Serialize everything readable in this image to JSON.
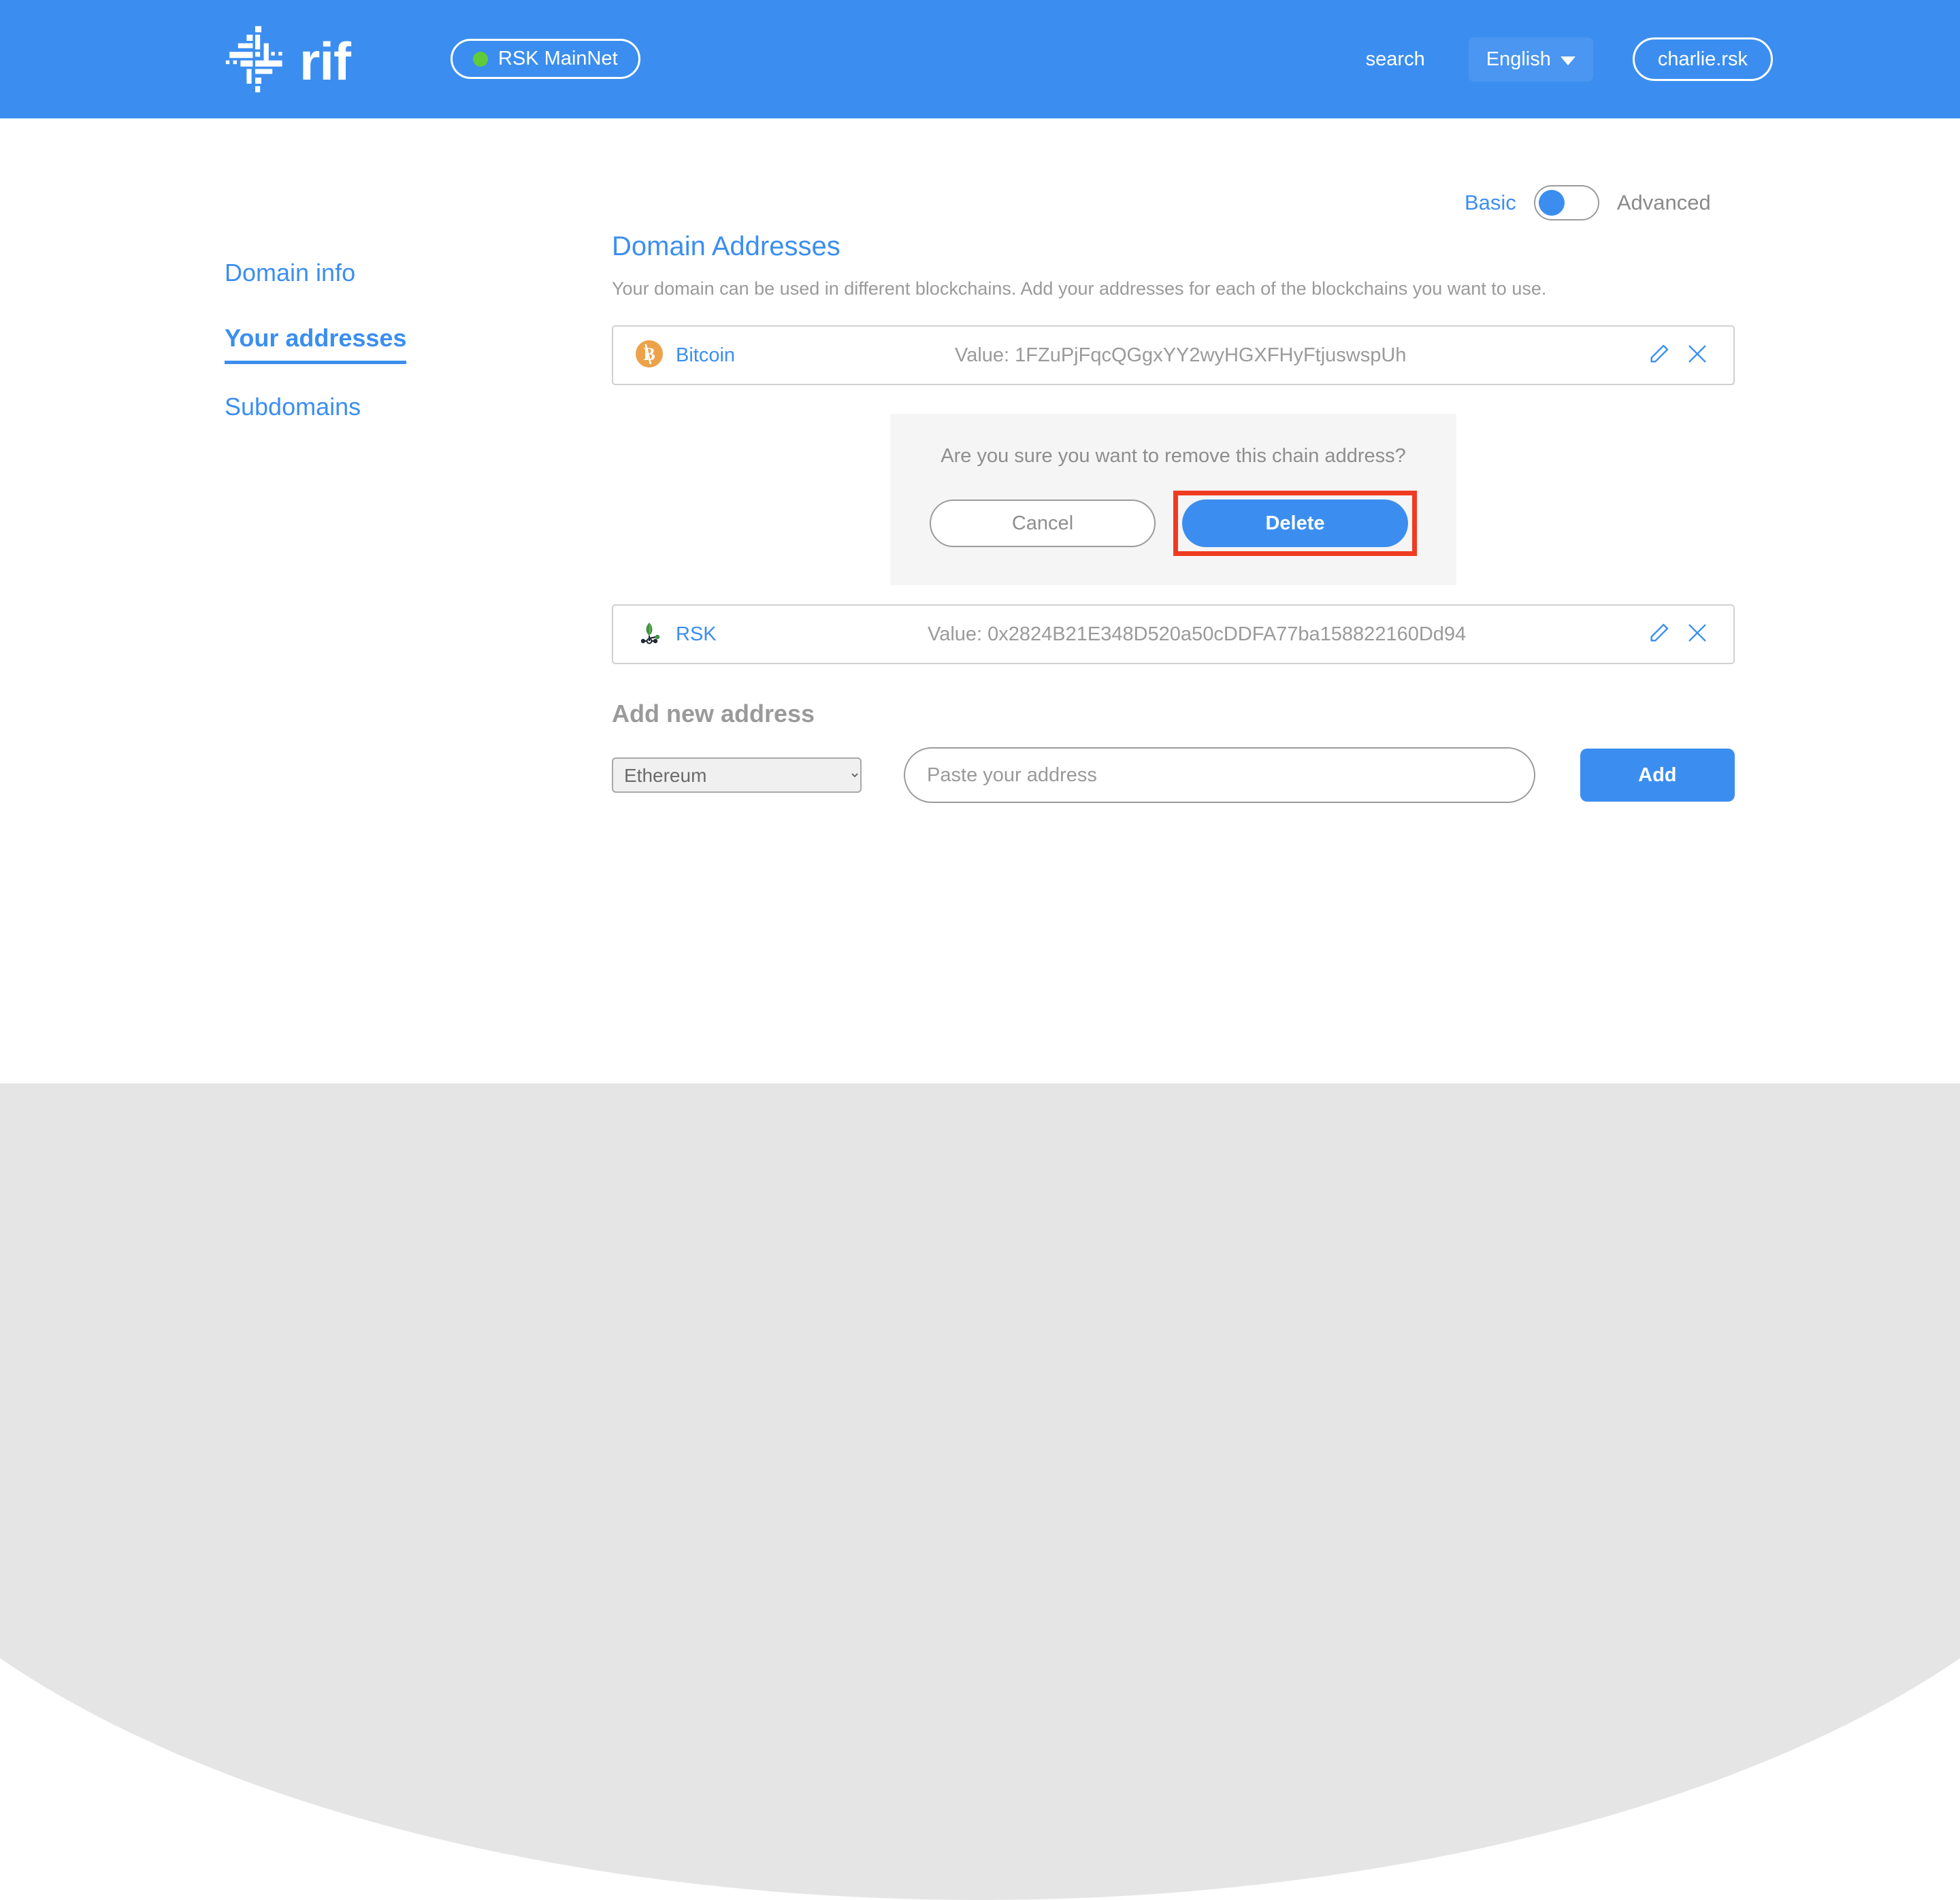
{
  "header": {
    "logo_text": "rif",
    "logo_icon": "rif-logo-icon",
    "network": {
      "label": "RSK MainNet",
      "status_dot": "green-status-dot",
      "dot_color": "#5fcb3a"
    },
    "search_label": "search",
    "language_label": "English",
    "language_caret": "chevron-down-icon",
    "account_label": "charlie.rsk",
    "background_color": "#3b8ef0"
  },
  "mode_toggle": {
    "basic_label": "Basic",
    "advanced_label": "Advanced",
    "selected": "Basic",
    "active_color": "#3b8ef0",
    "inactive_color": "#8a8a8a"
  },
  "sidebar": {
    "items": [
      {
        "label": "Domain info",
        "active": false
      },
      {
        "label": "Your addresses",
        "active": true
      },
      {
        "label": "Subdomains",
        "active": false
      }
    ]
  },
  "main": {
    "title": "Domain Addresses",
    "description": "Your domain can be used in different blockchains. Add your addresses for each of the blockchains you want to use.",
    "addresses": [
      {
        "chain": "Bitcoin",
        "chain_icon": "bitcoin-icon",
        "icon_color": "#eda24a",
        "value": "Value: 1FZuPjFqcQGgxYY2wyHGXFHyFtjuswspUh",
        "edit_icon": "pencil-icon",
        "delete_icon": "close-icon"
      },
      {
        "chain": "RSK",
        "chain_icon": "rsk-icon",
        "icon_color": "#4d8c3f",
        "value": "Value: 0x2824B21E348D520a50cDDFA77ba158822160Dd94",
        "edit_icon": "pencil-icon",
        "delete_icon": "close-icon"
      }
    ]
  },
  "confirm_dialog": {
    "message": "Are you sure you want to remove this chain address?",
    "cancel_label": "Cancel",
    "delete_label": "Delete",
    "highlight_color": "#ef3b22",
    "panel_background": "#f5f5f5"
  },
  "add_new_address": {
    "title": "Add new address",
    "chain_selected": "Ethereum",
    "chain_options": [
      "Ethereum"
    ],
    "address_placeholder": "Paste your address",
    "address_value": "",
    "add_label": "Add"
  }
}
